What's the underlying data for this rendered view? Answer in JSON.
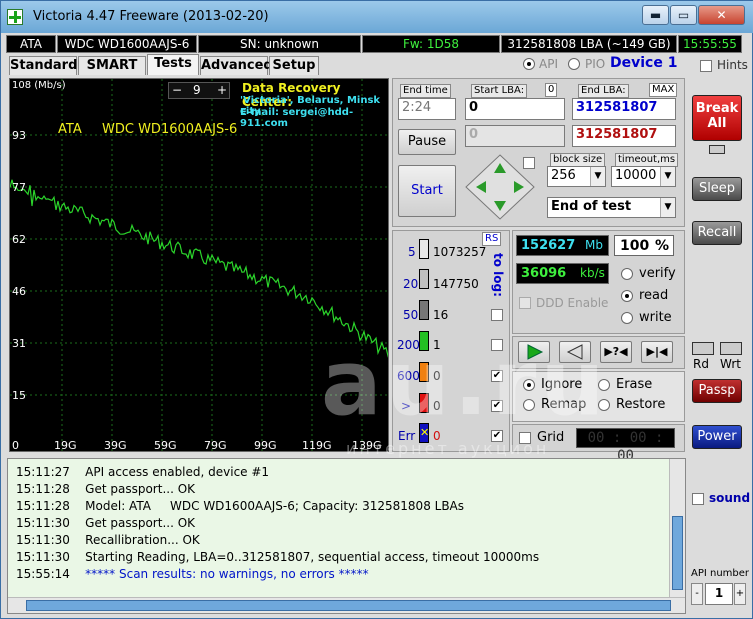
{
  "window": {
    "title": "Victoria 4.47  Freeware (2013-02-20)",
    "btn_min": "▬",
    "btn_max": "▭",
    "btn_close": "✕"
  },
  "status": {
    "iface": "ATA",
    "model": "WDC WD1600AAJS-6",
    "sn": "SN: unknown",
    "fw": "Fw: 1D58",
    "lba": "312581808 LBA (~149 GB)",
    "clock": "15:55:55"
  },
  "mode": {
    "api": "API",
    "pio": "PIO",
    "device": "Device 1",
    "hints": "Hints"
  },
  "tabs": [
    "Standard",
    "SMART",
    "Tests",
    "Advanced",
    "Setup"
  ],
  "graph": {
    "unit": "108 (Mb/s)",
    "y_ticks": [
      "108",
      "93",
      "77",
      "62",
      "46",
      "31",
      "15",
      "0"
    ],
    "x_ticks": [
      "19G",
      "39G",
      "59G",
      "79G",
      "99G",
      "119G",
      "139G"
    ],
    "drive_iface": "ATA",
    "drive_model": "WDC WD1600AAJS-6",
    "spin_minus": "−",
    "spin_value": "9",
    "spin_plus": "+",
    "center_title": "Data Recovery Center:",
    "center_line1": "'Victoria', Belarus, Minsk city",
    "center_line2": "E-mail: sergei@hdd-911.com"
  },
  "test": {
    "end_time_label": "End time",
    "end_time": "2:24",
    "start_lba_label": "Start LBA:",
    "start_lba_zero": "0",
    "start_lba": "0",
    "start_lba_cur": "0",
    "end_lba_label": "End LBA:",
    "max_label": "MAX",
    "end_lba": "312581807",
    "end_lba_cur": "312581807",
    "pause": "Pause",
    "start": "Start",
    "block_size_label": "block size",
    "block_size": "256",
    "timeout_label": "timeout,ms",
    "timeout": "10000",
    "end_of_test": "End of test"
  },
  "blocks": {
    "rs": "RS",
    "to_log": "to log:",
    "rows": [
      {
        "ms": "5",
        "count": "1073257"
      },
      {
        "ms": "20",
        "count": "147750"
      },
      {
        "ms": "50",
        "count": "16"
      },
      {
        "ms": "200",
        "count": "1"
      },
      {
        "ms": "600",
        "count": "0"
      },
      {
        "ms": ">",
        "count": "0"
      },
      {
        "ms": "Err",
        "count": "0"
      }
    ]
  },
  "stats": {
    "mb": "152627",
    "mb_unit": "Mb",
    "percent": "100",
    "percent_unit": "%",
    "speed": "36096",
    "speed_unit": "kb/s",
    "ddd": "DDD Enable",
    "verify": "verify",
    "read": "read",
    "write": "write",
    "ignore": "Ignore",
    "erase": "Erase",
    "remap": "Remap",
    "restore": "Restore",
    "grid": "Grid",
    "timer": "00 : 00 : 00"
  },
  "side": {
    "break": "Break All",
    "sleep": "Sleep",
    "recall": "Recall",
    "rd": "Rd",
    "wrt": "Wrt",
    "passp": "Passp",
    "power": "Power",
    "sound": "sound",
    "api_number": "API number",
    "api_value": "1"
  },
  "log": [
    {
      "time": "15:11:27",
      "msg": "API access enabled, device #1"
    },
    {
      "time": "15:11:28",
      "msg": "Get passport... OK"
    },
    {
      "time": "15:11:28",
      "msg": "Model: ATA     WDC WD1600AAJS-6; Capacity: 312581808 LBAs"
    },
    {
      "time": "15:11:30",
      "msg": "Get passport... OK"
    },
    {
      "time": "15:11:30",
      "msg": "Recallibration... OK"
    },
    {
      "time": "15:11:30",
      "msg": "Starting Reading, LBA=0..312581807, sequential access, timeout 10000ms"
    },
    {
      "time": "15:55:14",
      "msg": "***** Scan results: no warnings, no errors *****"
    }
  ],
  "watermark": {
    "main": "au.ru",
    "sub": "интернет аукцион"
  },
  "colors": {
    "graph_line": "#2bd42b",
    "accent_blue": "#0000cc",
    "break_red": "#d01818"
  }
}
